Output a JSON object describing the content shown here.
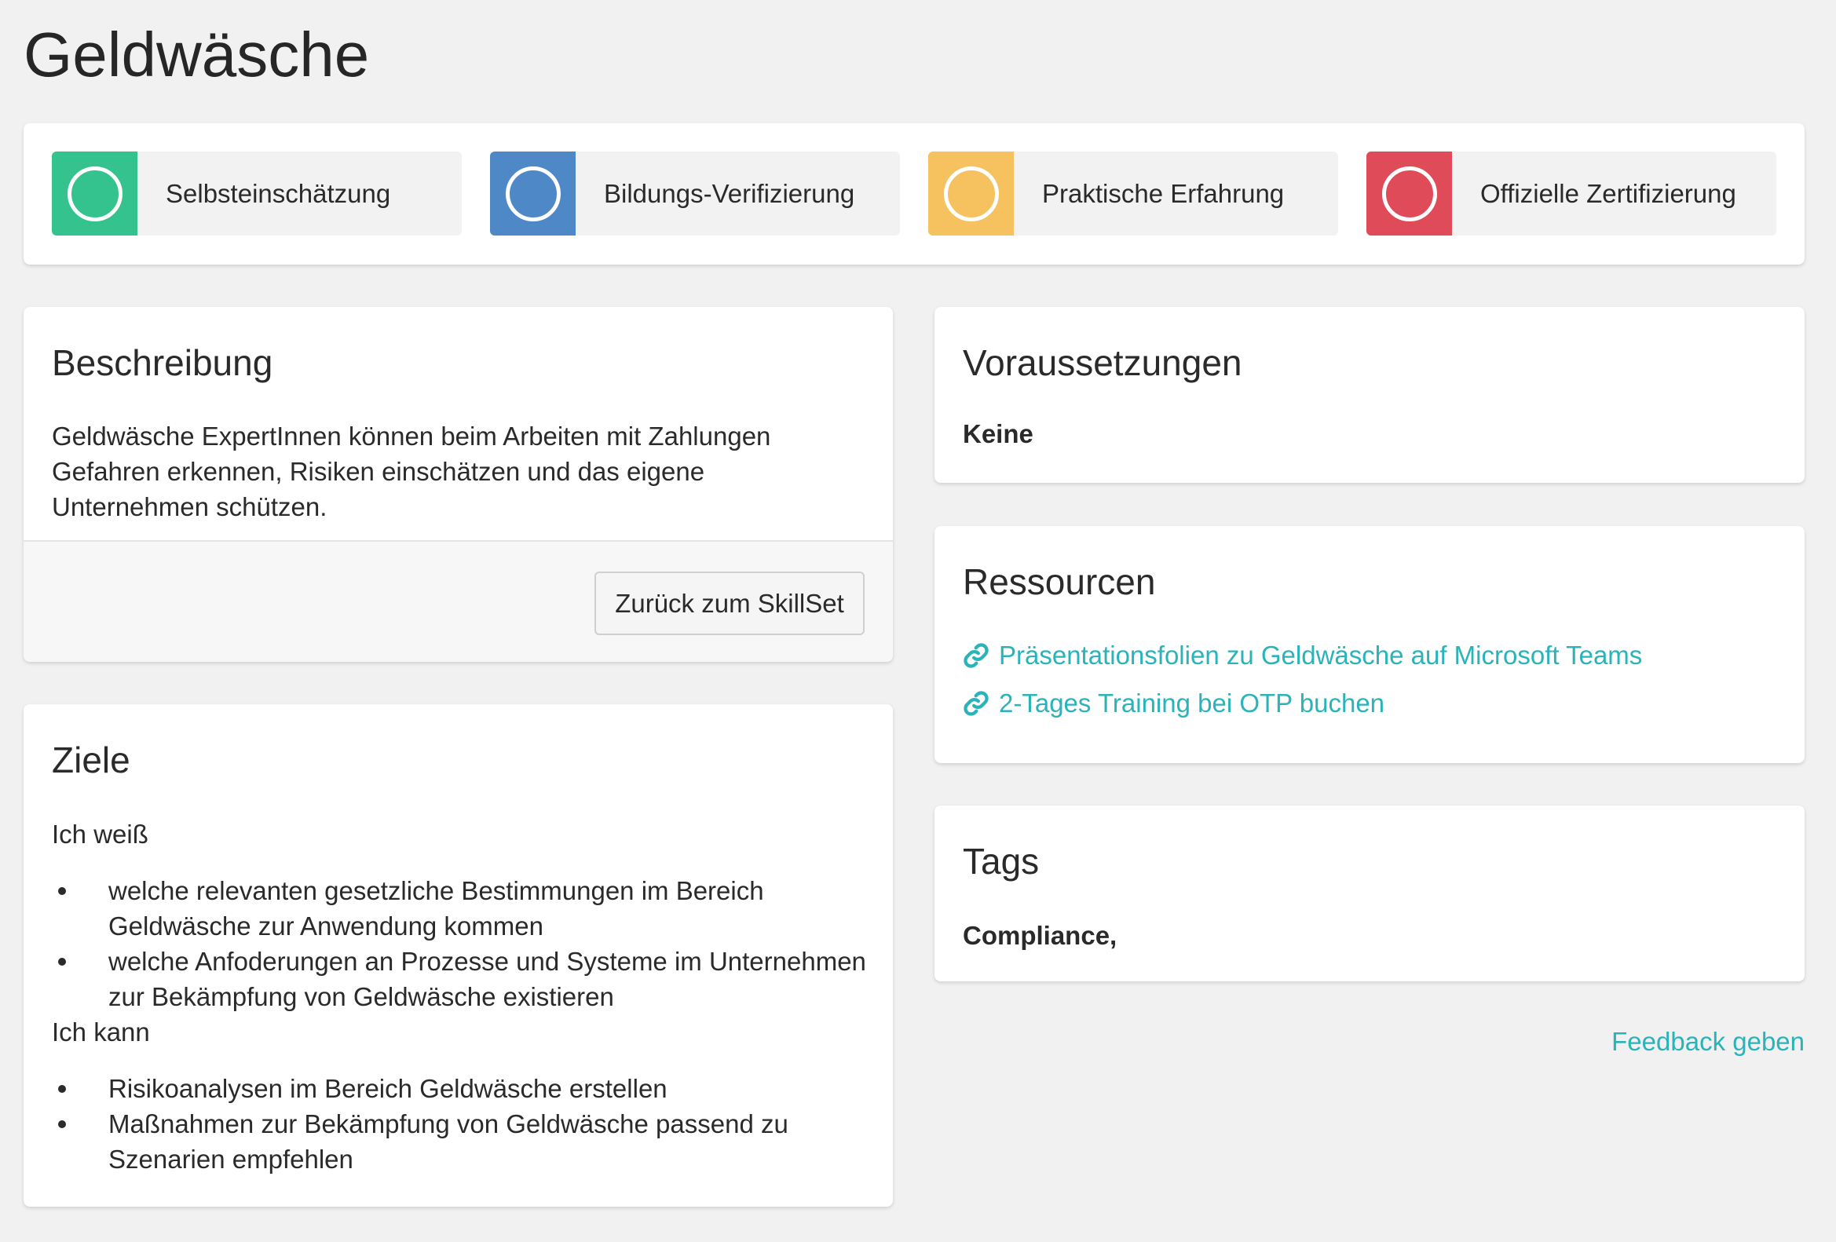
{
  "page": {
    "title": "Geldwäsche"
  },
  "status": {
    "items": [
      {
        "label": "Selbsteinschätzung",
        "color": "#34c28f"
      },
      {
        "label": "Bildungs-Verifizierung",
        "color": "#4e88c7"
      },
      {
        "label": "Praktische Erfahrung",
        "color": "#f6c15f"
      },
      {
        "label": "Offizielle Zertifizierung",
        "color": "#e04b5a"
      }
    ]
  },
  "description": {
    "heading": "Beschreibung",
    "text": "Geldwäsche ExpertInnen können beim Arbeiten mit Zahlungen Gefahren erkennen, Risiken einschätzen und das eigene Unternehmen schützen.",
    "back_button": "Zurück zum SkillSet"
  },
  "goals": {
    "heading": "Ziele",
    "intro1": "Ich weiß",
    "list1": [
      "welche relevanten gesetzliche Bestimmungen im Bereich Geldwäsche zur Anwendung kommen",
      "welche Anfoderungen an Prozesse und Systeme im Unternehmen zur Bekämpfung von Geldwäsche existieren"
    ],
    "intro2": "Ich kann",
    "list2": [
      "Risikoanalysen im Bereich Geldwäsche erstellen",
      "Maßnahmen zur Bekämpfung von Geldwäsche passend zu Szenarien empfehlen"
    ]
  },
  "requirements": {
    "heading": "Voraussetzungen",
    "value": "Keine"
  },
  "resources": {
    "heading": "Ressourcen",
    "links": [
      {
        "label": "Präsentationsfolien zu Geldwäsche auf Microsoft Teams",
        "icon": "link-icon"
      },
      {
        "label": "2-Tages Training bei OTP buchen",
        "icon": "link-icon"
      }
    ],
    "link_color": "#2ab3b8"
  },
  "tags": {
    "heading": "Tags",
    "value": "Compliance,"
  },
  "footer": {
    "feedback": "Feedback geben"
  }
}
